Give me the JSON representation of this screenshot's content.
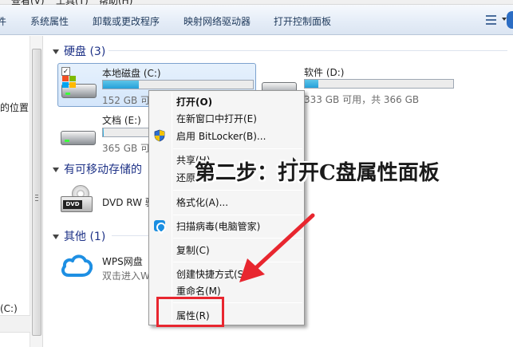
{
  "menubar": {
    "items": [
      "查看(V)",
      "工具(T)",
      "帮助(H)"
    ]
  },
  "toolbar": {
    "items": [
      "件",
      "系统属性",
      "卸载或更改程序",
      "映射网络驱动器",
      "打开控制面板"
    ]
  },
  "nav": {
    "item_location": "的位置",
    "item_drive": "(C:)"
  },
  "sections": {
    "hdd": "硬盘 (3)",
    "removable": "有可移动存储的",
    "other": "其他 (1)"
  },
  "drives": {
    "c": {
      "name": "本地磁盘 (C:)",
      "sub": "152 GB 可",
      "used_fraction": 0.24
    },
    "d": {
      "name": "软件 (D:)",
      "sub": "333 GB 可用，共 366 GB",
      "used_fraction": 0.09
    },
    "e": {
      "name": "文档 (E:)",
      "sub": "365 GB 可",
      "used_fraction": 0.01
    },
    "dvd": {
      "name": "DVD RW 驱"
    },
    "wps": {
      "name": "WPS网盘",
      "sub": "双击进入W"
    }
  },
  "context_menu": {
    "open": "打开(O)",
    "open_new_window": "在新窗口中打开(E)",
    "bitlocker": "启用 BitLocker(B)...",
    "share": "共享(H)",
    "restore": "还原以",
    "format": "格式化(A)...",
    "scan": "扫描病毒(电脑管家)",
    "copy": "复制(C)",
    "create_shortcut": "创建快捷方式(S)",
    "rename": "重命名(M)",
    "properties": "属性(R)"
  },
  "annotation": {
    "text": "第二步：打开C盘属性面板"
  },
  "colors": {
    "accent": "#26a0da",
    "highlight": "#e8262f",
    "section": "#1e3287"
  }
}
